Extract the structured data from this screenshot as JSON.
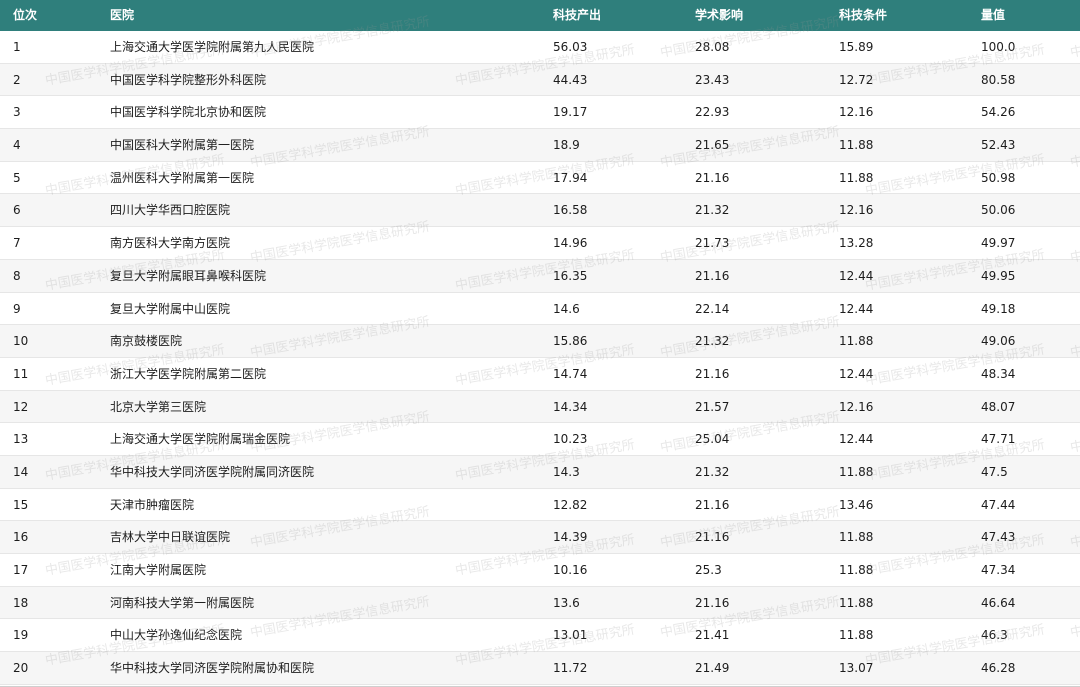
{
  "header": {
    "rank": "位次",
    "hospital": "医院",
    "sci_output": "科技产出",
    "academic_impact": "学术影响",
    "sci_conditions": "科技条件",
    "score": "量值"
  },
  "watermark_text": "中国医学科学院医学信息研究所",
  "rows": [
    {
      "rank": "1",
      "hospital": "上海交通大学医学院附属第九人民医院",
      "sci_output": "56.03",
      "academic_impact": "28.08",
      "sci_conditions": "15.89",
      "score": "100.0"
    },
    {
      "rank": "2",
      "hospital": "中国医学科学院整形外科医院",
      "sci_output": "44.43",
      "academic_impact": "23.43",
      "sci_conditions": "12.72",
      "score": "80.58"
    },
    {
      "rank": "3",
      "hospital": "中国医学科学院北京协和医院",
      "sci_output": "19.17",
      "academic_impact": "22.93",
      "sci_conditions": "12.16",
      "score": "54.26"
    },
    {
      "rank": "4",
      "hospital": "中国医科大学附属第一医院",
      "sci_output": "18.9",
      "academic_impact": "21.65",
      "sci_conditions": "11.88",
      "score": "52.43"
    },
    {
      "rank": "5",
      "hospital": "温州医科大学附属第一医院",
      "sci_output": "17.94",
      "academic_impact": "21.16",
      "sci_conditions": "11.88",
      "score": "50.98"
    },
    {
      "rank": "6",
      "hospital": "四川大学华西口腔医院",
      "sci_output": "16.58",
      "academic_impact": "21.32",
      "sci_conditions": "12.16",
      "score": "50.06"
    },
    {
      "rank": "7",
      "hospital": "南方医科大学南方医院",
      "sci_output": "14.96",
      "academic_impact": "21.73",
      "sci_conditions": "13.28",
      "score": "49.97"
    },
    {
      "rank": "8",
      "hospital": "复旦大学附属眼耳鼻喉科医院",
      "sci_output": "16.35",
      "academic_impact": "21.16",
      "sci_conditions": "12.44",
      "score": "49.95"
    },
    {
      "rank": "9",
      "hospital": "复旦大学附属中山医院",
      "sci_output": "14.6",
      "academic_impact": "22.14",
      "sci_conditions": "12.44",
      "score": "49.18"
    },
    {
      "rank": "10",
      "hospital": "南京鼓楼医院",
      "sci_output": "15.86",
      "academic_impact": "21.32",
      "sci_conditions": "11.88",
      "score": "49.06"
    },
    {
      "rank": "11",
      "hospital": "浙江大学医学院附属第二医院",
      "sci_output": "14.74",
      "academic_impact": "21.16",
      "sci_conditions": "12.44",
      "score": "48.34"
    },
    {
      "rank": "12",
      "hospital": "北京大学第三医院",
      "sci_output": "14.34",
      "academic_impact": "21.57",
      "sci_conditions": "12.16",
      "score": "48.07"
    },
    {
      "rank": "13",
      "hospital": "上海交通大学医学院附属瑞金医院",
      "sci_output": "10.23",
      "academic_impact": "25.04",
      "sci_conditions": "12.44",
      "score": "47.71"
    },
    {
      "rank": "14",
      "hospital": "华中科技大学同济医学院附属同济医院",
      "sci_output": "14.3",
      "academic_impact": "21.32",
      "sci_conditions": "11.88",
      "score": "47.5"
    },
    {
      "rank": "15",
      "hospital": "天津市肿瘤医院",
      "sci_output": "12.82",
      "academic_impact": "21.16",
      "sci_conditions": "13.46",
      "score": "47.44"
    },
    {
      "rank": "16",
      "hospital": "吉林大学中日联谊医院",
      "sci_output": "14.39",
      "academic_impact": "21.16",
      "sci_conditions": "11.88",
      "score": "47.43"
    },
    {
      "rank": "17",
      "hospital": "江南大学附属医院",
      "sci_output": "10.16",
      "academic_impact": "25.3",
      "sci_conditions": "11.88",
      "score": "47.34"
    },
    {
      "rank": "18",
      "hospital": "河南科技大学第一附属医院",
      "sci_output": "13.6",
      "academic_impact": "21.16",
      "sci_conditions": "11.88",
      "score": "46.64"
    },
    {
      "rank": "19",
      "hospital": "中山大学孙逸仙纪念医院",
      "sci_output": "13.01",
      "academic_impact": "21.41",
      "sci_conditions": "11.88",
      "score": "46.3"
    },
    {
      "rank": "20",
      "hospital": "华中科技大学同济医学院附属协和医院",
      "sci_output": "11.72",
      "academic_impact": "21.49",
      "sci_conditions": "13.07",
      "score": "46.28"
    }
  ]
}
